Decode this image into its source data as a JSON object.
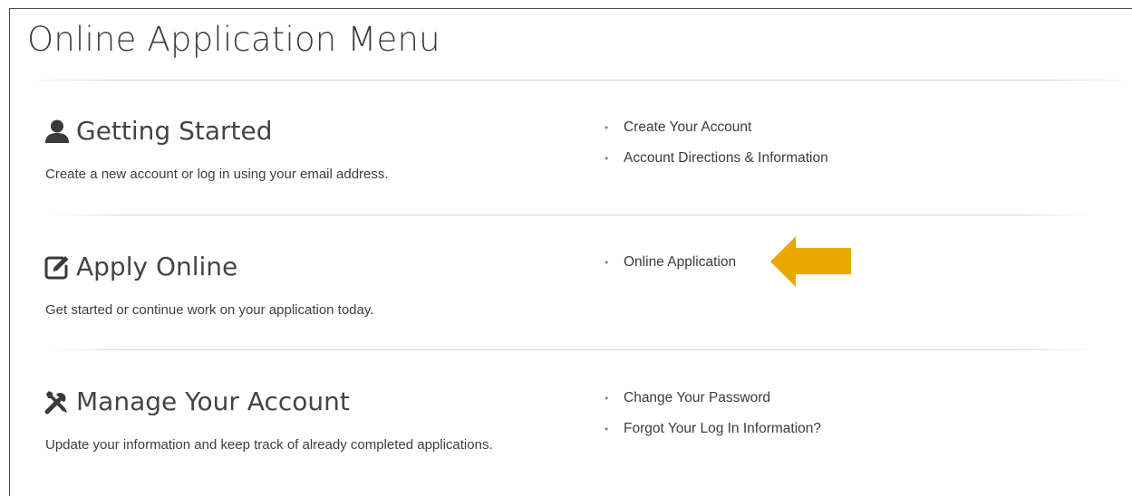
{
  "page": {
    "title": "Online Application Menu"
  },
  "colors": {
    "text": "#3c3c3c",
    "rule": "#c9d6dc",
    "arrow": "#e9a800"
  },
  "sections": [
    {
      "icon": "user-icon",
      "title": "Getting Started",
      "description": "Create a new account or log in using your email address.",
      "links": [
        "Create Your Account",
        "Account Directions & Information"
      ]
    },
    {
      "icon": "edit-icon",
      "title": "Apply Online",
      "description": "Get started or continue work on your application today.",
      "links": [
        "Online Application"
      ]
    },
    {
      "icon": "tools-icon",
      "title": "Manage Your Account",
      "description": "Update your information and keep track of already completed applications.",
      "links": [
        "Change Your Password",
        "Forgot Your Log In Information?"
      ]
    }
  ],
  "annotation": {
    "icon": "arrow-left-icon",
    "points_to": "Online Application"
  }
}
